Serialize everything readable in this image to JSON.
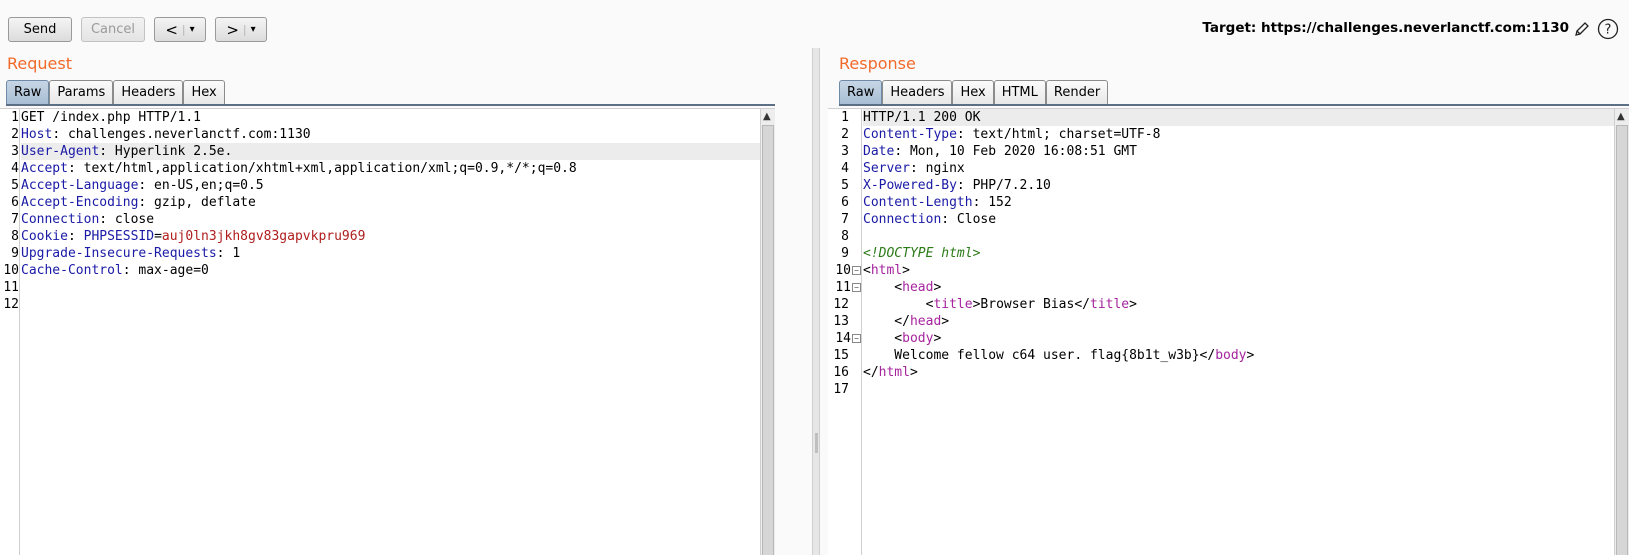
{
  "toolbar": {
    "send_label": "Send",
    "cancel_label": "Cancel",
    "back_label": "<",
    "forward_label": ">",
    "dropdown_glyph": "▾",
    "target_label": "Target: https://challenges.neverlanctf.com:1130"
  },
  "request": {
    "title": "Request",
    "tabs": [
      "Raw",
      "Params",
      "Headers",
      "Hex"
    ],
    "active_tab": "Raw",
    "lines": [
      {
        "n": "1",
        "segments": [
          {
            "t": "GET /index.php HTTP/1.1",
            "c": ""
          }
        ]
      },
      {
        "n": "2",
        "segments": [
          {
            "t": "Host",
            "c": "hname"
          },
          {
            "t": ": challenges.neverlanctf.com:1130",
            "c": ""
          }
        ]
      },
      {
        "n": "3",
        "hl": true,
        "segments": [
          {
            "t": "User-Agent",
            "c": "hname"
          },
          {
            "t": ": Hyperlink 2.5e.",
            "c": ""
          }
        ]
      },
      {
        "n": "4",
        "segments": [
          {
            "t": "Accept",
            "c": "hname"
          },
          {
            "t": ": text/html,application/xhtml+xml,application/xml;q=0.9,*/*;q=0.8",
            "c": ""
          }
        ]
      },
      {
        "n": "5",
        "segments": [
          {
            "t": "Accept-Language",
            "c": "hname"
          },
          {
            "t": ": en-US,en;q=0.5",
            "c": ""
          }
        ]
      },
      {
        "n": "6",
        "segments": [
          {
            "t": "Accept-Encoding",
            "c": "hname"
          },
          {
            "t": ": gzip, deflate",
            "c": ""
          }
        ]
      },
      {
        "n": "7",
        "segments": [
          {
            "t": "Connection",
            "c": "hname"
          },
          {
            "t": ": close",
            "c": ""
          }
        ]
      },
      {
        "n": "8",
        "segments": [
          {
            "t": "Cookie",
            "c": "hname"
          },
          {
            "t": ": ",
            "c": ""
          },
          {
            "t": "PHPSESSID",
            "c": "cookie-name"
          },
          {
            "t": "=",
            "c": ""
          },
          {
            "t": "auj0ln3jkh8gv83gapvkpru969",
            "c": "cookie-val"
          }
        ]
      },
      {
        "n": "9",
        "segments": [
          {
            "t": "Upgrade-Insecure-Requests",
            "c": "hname"
          },
          {
            "t": ": 1",
            "c": ""
          }
        ]
      },
      {
        "n": "10",
        "segments": [
          {
            "t": "Cache-Control",
            "c": "hname"
          },
          {
            "t": ": max-age=0",
            "c": ""
          }
        ]
      },
      {
        "n": "11",
        "segments": []
      },
      {
        "n": "12",
        "segments": []
      }
    ]
  },
  "response": {
    "title": "Response",
    "tabs": [
      "Raw",
      "Headers",
      "Hex",
      "HTML",
      "Render"
    ],
    "active_tab": "Raw",
    "lines": [
      {
        "n": "1",
        "hl": true,
        "segments": [
          {
            "t": "HTTP/1.1 200 OK",
            "c": ""
          }
        ]
      },
      {
        "n": "2",
        "segments": [
          {
            "t": "Content-Type",
            "c": "hname"
          },
          {
            "t": ": text/html; charset=UTF-8",
            "c": ""
          }
        ]
      },
      {
        "n": "3",
        "segments": [
          {
            "t": "Date",
            "c": "hname"
          },
          {
            "t": ": Mon, 10 Feb 2020 16:08:51 GMT",
            "c": ""
          }
        ]
      },
      {
        "n": "4",
        "segments": [
          {
            "t": "Server",
            "c": "hname"
          },
          {
            "t": ": nginx",
            "c": ""
          }
        ]
      },
      {
        "n": "5",
        "segments": [
          {
            "t": "X-Powered-By",
            "c": "hname"
          },
          {
            "t": ": PHP/7.2.10",
            "c": ""
          }
        ]
      },
      {
        "n": "6",
        "segments": [
          {
            "t": "Content-Length",
            "c": "hname"
          },
          {
            "t": ": 152",
            "c": ""
          }
        ]
      },
      {
        "n": "7",
        "segments": [
          {
            "t": "Connection",
            "c": "hname"
          },
          {
            "t": ": Close",
            "c": ""
          }
        ]
      },
      {
        "n": "8",
        "segments": []
      },
      {
        "n": "9",
        "segments": [
          {
            "t": "<!DOCTYPE html>",
            "c": "doctype"
          }
        ]
      },
      {
        "n": "10",
        "fold": true,
        "segments": [
          {
            "t": "<",
            "c": ""
          },
          {
            "t": "html",
            "c": "tag"
          },
          {
            "t": ">",
            "c": ""
          }
        ]
      },
      {
        "n": "11",
        "fold": true,
        "segments": [
          {
            "t": "    <",
            "c": ""
          },
          {
            "t": "head",
            "c": "tag"
          },
          {
            "t": ">",
            "c": ""
          }
        ]
      },
      {
        "n": "12",
        "segments": [
          {
            "t": "        <",
            "c": ""
          },
          {
            "t": "title",
            "c": "tag"
          },
          {
            "t": ">Browser Bias</",
            "c": ""
          },
          {
            "t": "title",
            "c": "tag"
          },
          {
            "t": ">",
            "c": ""
          }
        ]
      },
      {
        "n": "13",
        "segments": [
          {
            "t": "    </",
            "c": ""
          },
          {
            "t": "head",
            "c": "tag"
          },
          {
            "t": ">",
            "c": ""
          }
        ]
      },
      {
        "n": "14",
        "fold": true,
        "segments": [
          {
            "t": "    <",
            "c": ""
          },
          {
            "t": "body",
            "c": "tag"
          },
          {
            "t": ">",
            "c": ""
          }
        ]
      },
      {
        "n": "15",
        "segments": [
          {
            "t": "    Welcome fellow c64 user. flag{8b1t_w3b}</",
            "c": ""
          },
          {
            "t": "body",
            "c": "tag"
          },
          {
            "t": ">",
            "c": ""
          }
        ]
      },
      {
        "n": "16",
        "segments": [
          {
            "t": "</",
            "c": ""
          },
          {
            "t": "html",
            "c": "tag"
          },
          {
            "t": ">",
            "c": ""
          }
        ]
      },
      {
        "n": "17",
        "segments": []
      }
    ]
  },
  "icons": {
    "edit": "pencil-icon",
    "help": "help-icon"
  },
  "colors": {
    "title_orange": "#f26a2a",
    "header_name_blue": "#1a1aa6",
    "cookie_value_red": "#b01e1e",
    "tag_purple": "#a6249f",
    "doctype_green": "#2b7b17",
    "active_tab_blue": "#a8bdd3"
  }
}
